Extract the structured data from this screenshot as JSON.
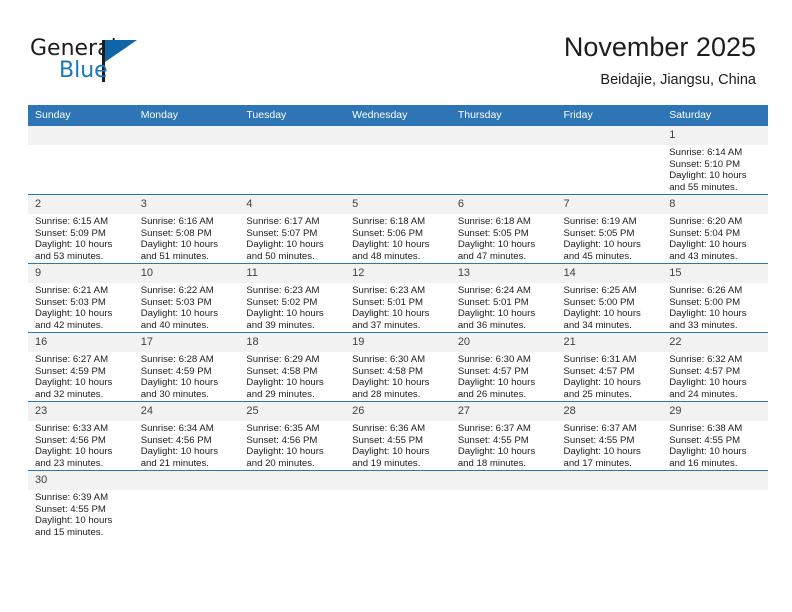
{
  "logo": {
    "word1": "General",
    "word2": "Blue",
    "accent_color": "#1064a8"
  },
  "header": {
    "month_title": "November 2025",
    "location": "Beidajie, Jiangsu, China"
  },
  "theme": {
    "header_bg": "#2e75b6",
    "daynum_bg": "#f2f2f2",
    "grid_line": "#2e75b6"
  },
  "calendar": {
    "weekdays": [
      "Sunday",
      "Monday",
      "Tuesday",
      "Wednesday",
      "Thursday",
      "Friday",
      "Saturday"
    ],
    "weeks": [
      [
        {
          "day": "",
          "empty": true
        },
        {
          "day": "",
          "empty": true
        },
        {
          "day": "",
          "empty": true
        },
        {
          "day": "",
          "empty": true
        },
        {
          "day": "",
          "empty": true
        },
        {
          "day": "",
          "empty": true
        },
        {
          "day": "1",
          "sunrise": "Sunrise: 6:14 AM",
          "sunset": "Sunset: 5:10 PM",
          "daylight1": "Daylight: 10 hours",
          "daylight2": "and 55 minutes."
        }
      ],
      [
        {
          "day": "2",
          "sunrise": "Sunrise: 6:15 AM",
          "sunset": "Sunset: 5:09 PM",
          "daylight1": "Daylight: 10 hours",
          "daylight2": "and 53 minutes."
        },
        {
          "day": "3",
          "sunrise": "Sunrise: 6:16 AM",
          "sunset": "Sunset: 5:08 PM",
          "daylight1": "Daylight: 10 hours",
          "daylight2": "and 51 minutes."
        },
        {
          "day": "4",
          "sunrise": "Sunrise: 6:17 AM",
          "sunset": "Sunset: 5:07 PM",
          "daylight1": "Daylight: 10 hours",
          "daylight2": "and 50 minutes."
        },
        {
          "day": "5",
          "sunrise": "Sunrise: 6:18 AM",
          "sunset": "Sunset: 5:06 PM",
          "daylight1": "Daylight: 10 hours",
          "daylight2": "and 48 minutes."
        },
        {
          "day": "6",
          "sunrise": "Sunrise: 6:18 AM",
          "sunset": "Sunset: 5:05 PM",
          "daylight1": "Daylight: 10 hours",
          "daylight2": "and 47 minutes."
        },
        {
          "day": "7",
          "sunrise": "Sunrise: 6:19 AM",
          "sunset": "Sunset: 5:05 PM",
          "daylight1": "Daylight: 10 hours",
          "daylight2": "and 45 minutes."
        },
        {
          "day": "8",
          "sunrise": "Sunrise: 6:20 AM",
          "sunset": "Sunset: 5:04 PM",
          "daylight1": "Daylight: 10 hours",
          "daylight2": "and 43 minutes."
        }
      ],
      [
        {
          "day": "9",
          "sunrise": "Sunrise: 6:21 AM",
          "sunset": "Sunset: 5:03 PM",
          "daylight1": "Daylight: 10 hours",
          "daylight2": "and 42 minutes."
        },
        {
          "day": "10",
          "sunrise": "Sunrise: 6:22 AM",
          "sunset": "Sunset: 5:03 PM",
          "daylight1": "Daylight: 10 hours",
          "daylight2": "and 40 minutes."
        },
        {
          "day": "11",
          "sunrise": "Sunrise: 6:23 AM",
          "sunset": "Sunset: 5:02 PM",
          "daylight1": "Daylight: 10 hours",
          "daylight2": "and 39 minutes."
        },
        {
          "day": "12",
          "sunrise": "Sunrise: 6:23 AM",
          "sunset": "Sunset: 5:01 PM",
          "daylight1": "Daylight: 10 hours",
          "daylight2": "and 37 minutes."
        },
        {
          "day": "13",
          "sunrise": "Sunrise: 6:24 AM",
          "sunset": "Sunset: 5:01 PM",
          "daylight1": "Daylight: 10 hours",
          "daylight2": "and 36 minutes."
        },
        {
          "day": "14",
          "sunrise": "Sunrise: 6:25 AM",
          "sunset": "Sunset: 5:00 PM",
          "daylight1": "Daylight: 10 hours",
          "daylight2": "and 34 minutes."
        },
        {
          "day": "15",
          "sunrise": "Sunrise: 6:26 AM",
          "sunset": "Sunset: 5:00 PM",
          "daylight1": "Daylight: 10 hours",
          "daylight2": "and 33 minutes."
        }
      ],
      [
        {
          "day": "16",
          "sunrise": "Sunrise: 6:27 AM",
          "sunset": "Sunset: 4:59 PM",
          "daylight1": "Daylight: 10 hours",
          "daylight2": "and 32 minutes."
        },
        {
          "day": "17",
          "sunrise": "Sunrise: 6:28 AM",
          "sunset": "Sunset: 4:59 PM",
          "daylight1": "Daylight: 10 hours",
          "daylight2": "and 30 minutes."
        },
        {
          "day": "18",
          "sunrise": "Sunrise: 6:29 AM",
          "sunset": "Sunset: 4:58 PM",
          "daylight1": "Daylight: 10 hours",
          "daylight2": "and 29 minutes."
        },
        {
          "day": "19",
          "sunrise": "Sunrise: 6:30 AM",
          "sunset": "Sunset: 4:58 PM",
          "daylight1": "Daylight: 10 hours",
          "daylight2": "and 28 minutes."
        },
        {
          "day": "20",
          "sunrise": "Sunrise: 6:30 AM",
          "sunset": "Sunset: 4:57 PM",
          "daylight1": "Daylight: 10 hours",
          "daylight2": "and 26 minutes."
        },
        {
          "day": "21",
          "sunrise": "Sunrise: 6:31 AM",
          "sunset": "Sunset: 4:57 PM",
          "daylight1": "Daylight: 10 hours",
          "daylight2": "and 25 minutes."
        },
        {
          "day": "22",
          "sunrise": "Sunrise: 6:32 AM",
          "sunset": "Sunset: 4:57 PM",
          "daylight1": "Daylight: 10 hours",
          "daylight2": "and 24 minutes."
        }
      ],
      [
        {
          "day": "23",
          "sunrise": "Sunrise: 6:33 AM",
          "sunset": "Sunset: 4:56 PM",
          "daylight1": "Daylight: 10 hours",
          "daylight2": "and 23 minutes."
        },
        {
          "day": "24",
          "sunrise": "Sunrise: 6:34 AM",
          "sunset": "Sunset: 4:56 PM",
          "daylight1": "Daylight: 10 hours",
          "daylight2": "and 21 minutes."
        },
        {
          "day": "25",
          "sunrise": "Sunrise: 6:35 AM",
          "sunset": "Sunset: 4:56 PM",
          "daylight1": "Daylight: 10 hours",
          "daylight2": "and 20 minutes."
        },
        {
          "day": "26",
          "sunrise": "Sunrise: 6:36 AM",
          "sunset": "Sunset: 4:55 PM",
          "daylight1": "Daylight: 10 hours",
          "daylight2": "and 19 minutes."
        },
        {
          "day": "27",
          "sunrise": "Sunrise: 6:37 AM",
          "sunset": "Sunset: 4:55 PM",
          "daylight1": "Daylight: 10 hours",
          "daylight2": "and 18 minutes."
        },
        {
          "day": "28",
          "sunrise": "Sunrise: 6:37 AM",
          "sunset": "Sunset: 4:55 PM",
          "daylight1": "Daylight: 10 hours",
          "daylight2": "and 17 minutes."
        },
        {
          "day": "29",
          "sunrise": "Sunrise: 6:38 AM",
          "sunset": "Sunset: 4:55 PM",
          "daylight1": "Daylight: 10 hours",
          "daylight2": "and 16 minutes."
        }
      ],
      [
        {
          "day": "30",
          "sunrise": "Sunrise: 6:39 AM",
          "sunset": "Sunset: 4:55 PM",
          "daylight1": "Daylight: 10 hours",
          "daylight2": "and 15 minutes."
        },
        {
          "day": "",
          "empty": true
        },
        {
          "day": "",
          "empty": true
        },
        {
          "day": "",
          "empty": true
        },
        {
          "day": "",
          "empty": true
        },
        {
          "day": "",
          "empty": true
        },
        {
          "day": "",
          "empty": true
        }
      ]
    ]
  }
}
